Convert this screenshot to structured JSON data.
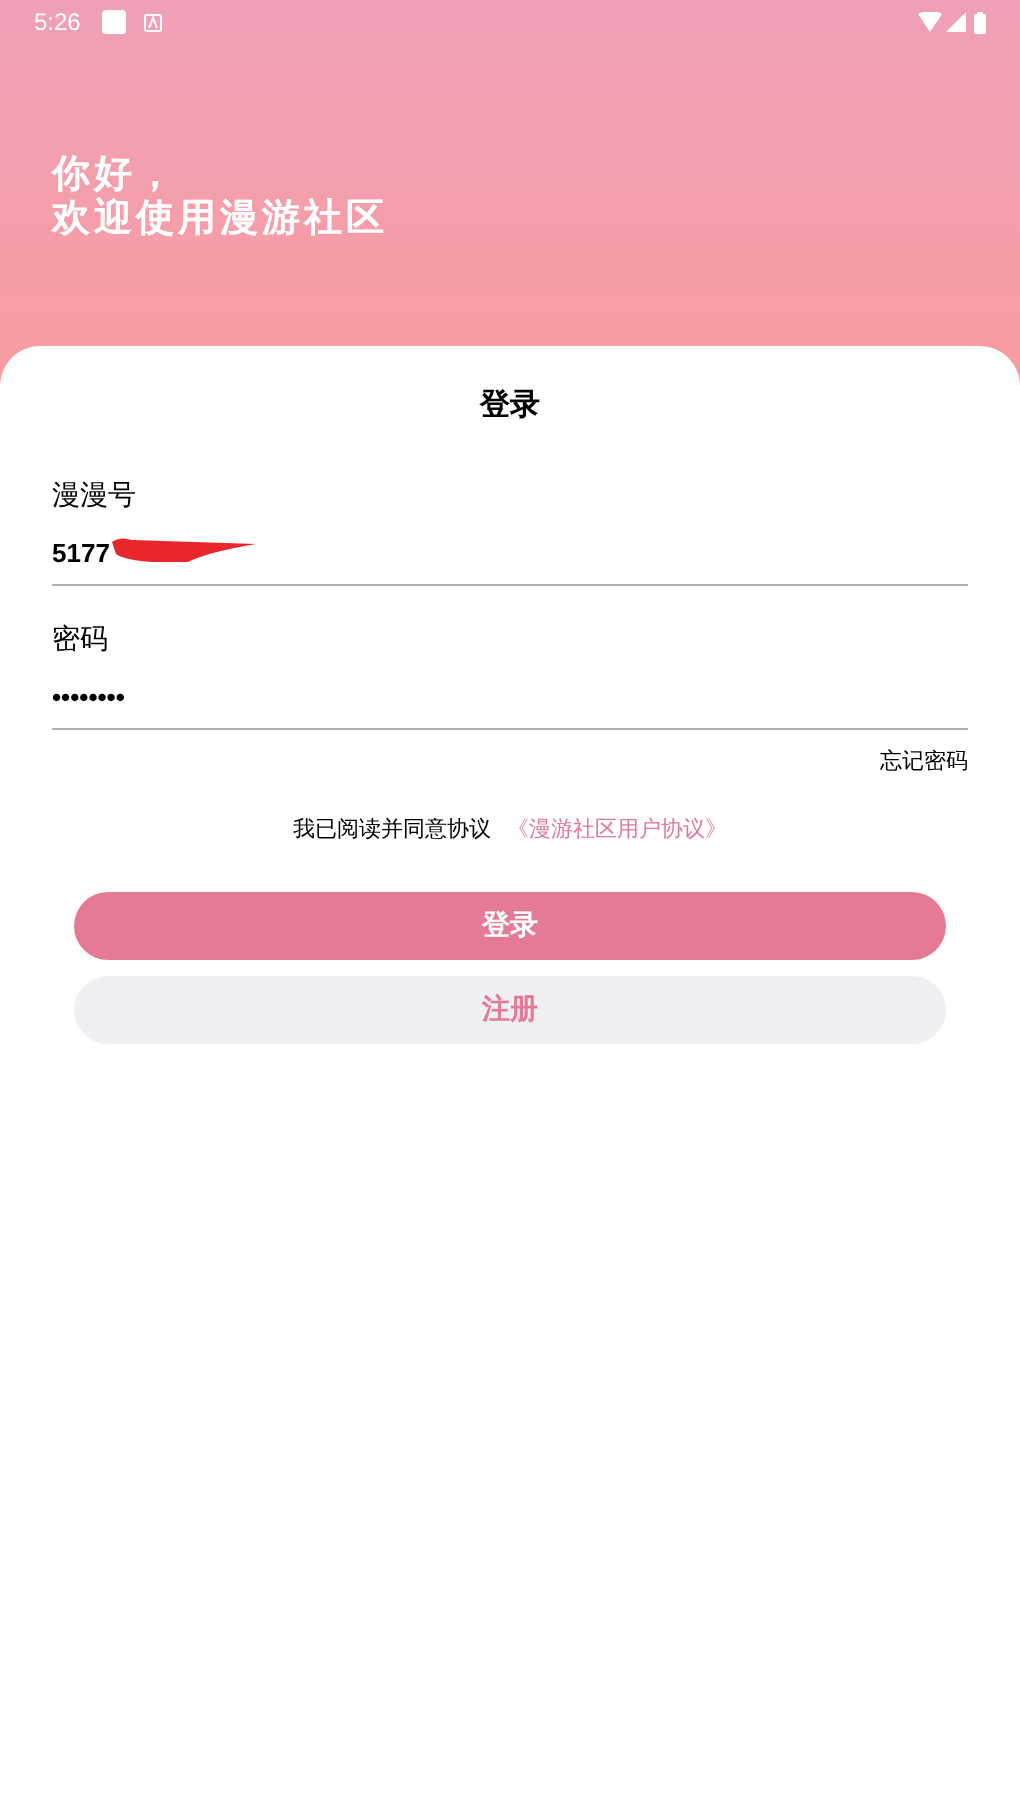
{
  "status_bar": {
    "time": "5:26"
  },
  "greeting": [
    "你好，",
    "欢迎使用漫游社区"
  ],
  "card": {
    "title": "登录"
  },
  "fields": [
    {
      "label": "漫漫号",
      "value": "5177",
      "redacted": true
    },
    {
      "label": "密码",
      "value": "••••••••"
    }
  ],
  "forgot_password": "忘记密码",
  "agreement": {
    "text": "我已阅读并同意协议",
    "link": "《漫游社区用户协议》"
  },
  "buttons": [
    {
      "label": "登录",
      "kind": "primary"
    },
    {
      "label": "注册",
      "kind": "secondary"
    }
  ]
}
